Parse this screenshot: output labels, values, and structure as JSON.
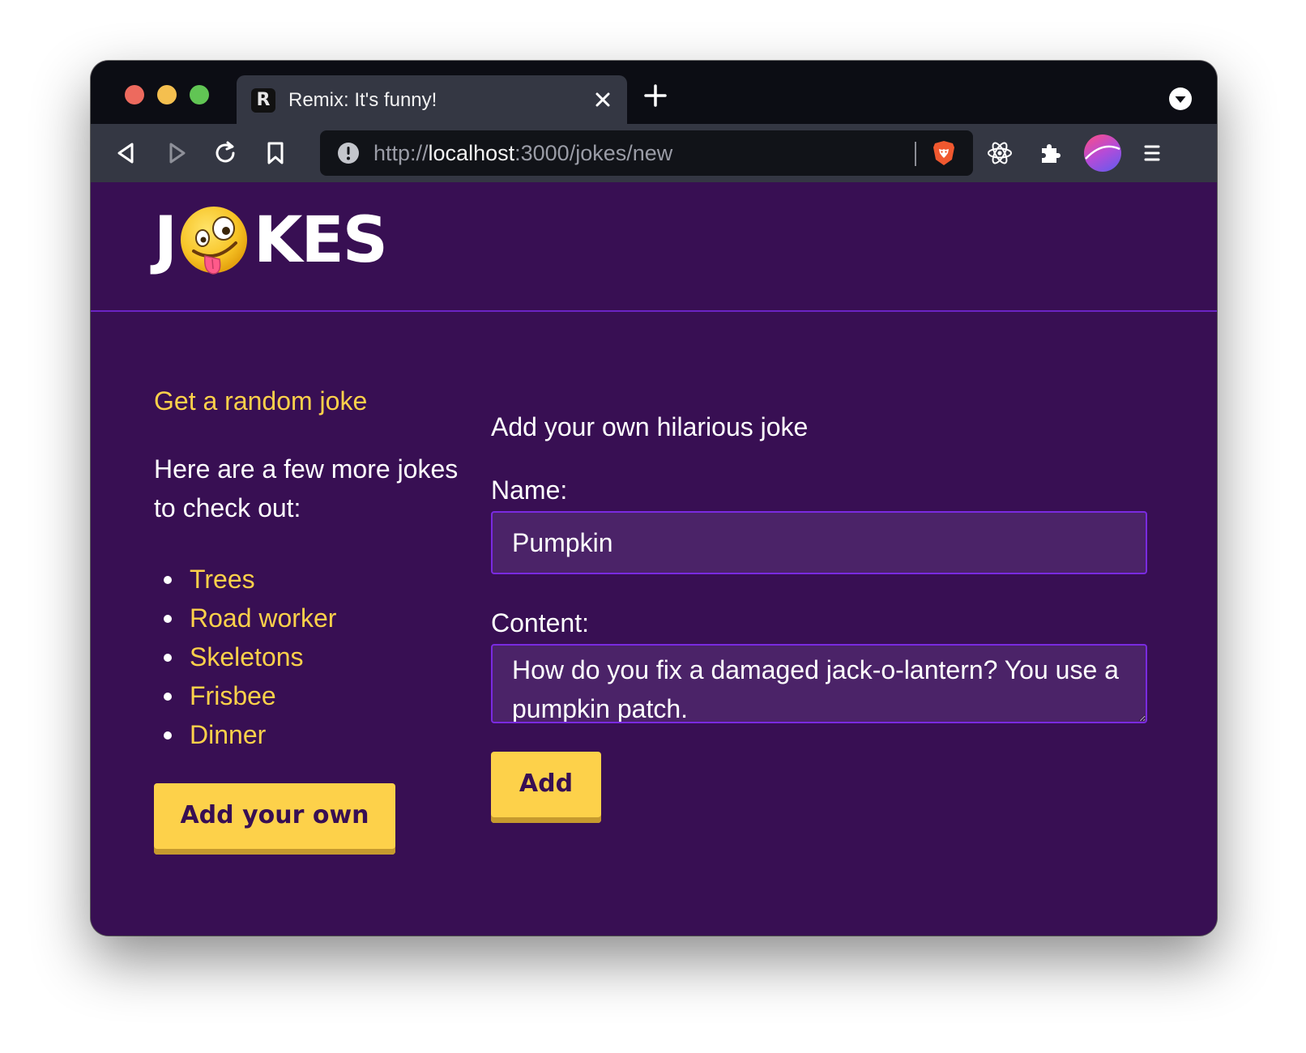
{
  "browser": {
    "tab": {
      "favicon_letter": "R",
      "title": "Remix: It's funny!"
    },
    "url": {
      "scheme": "http://",
      "host": "localhost",
      "rest": ":3000/jokes/new"
    },
    "colors": {
      "titlebar": "#0c0d14",
      "toolbar": "#343743",
      "urlbar": "#111318"
    },
    "icons": [
      "back-icon",
      "forward-icon",
      "reload-icon",
      "bookmark-icon",
      "info-icon",
      "brave-shield-icon",
      "react-devtools-icon",
      "extensions-icon",
      "profile-avatar",
      "menu-icon"
    ]
  },
  "site": {
    "logo": {
      "first_letter": "J",
      "rest": "KES",
      "emoji": "zany-face-emoji"
    },
    "colors": {
      "background": "#380f53",
      "accent": "#fdd14a",
      "border": "#6b24c4",
      "input_bg": "#4b2368"
    }
  },
  "sidebar": {
    "random_link": "Get a random joke",
    "intro": "Here are a few more jokes to check out:",
    "jokes": [
      "Trees",
      "Road worker",
      "Skeletons",
      "Frisbee",
      "Dinner"
    ],
    "add_own_label": "Add your own"
  },
  "form": {
    "title": "Add your own hilarious joke",
    "name_label": "Name:",
    "name_value": "Pumpkin",
    "content_label": "Content:",
    "content_value": "How do you fix a damaged jack-o-lantern? You use a pumpkin patch.",
    "submit_label": "Add"
  }
}
